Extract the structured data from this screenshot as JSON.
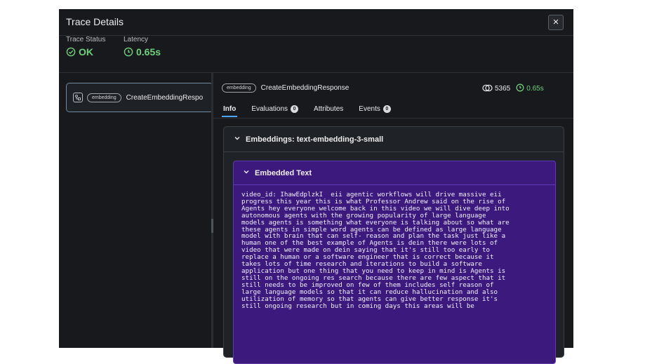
{
  "header": {
    "title": "Trace Details",
    "close_label": "×"
  },
  "status": {
    "status_label": "Trace Status",
    "status_value": "OK",
    "latency_label": "Latency",
    "latency_value": "0.65s",
    "ok_color": "#6fd17b"
  },
  "span_list": {
    "items": [
      {
        "icon": "embedding-kind-icon",
        "badge": "embedding",
        "name": "CreateEmbeddingResponse",
        "shown_name": "CreateEmbeddingRespo"
      }
    ]
  },
  "detail": {
    "badge": "embedding",
    "name": "CreateEmbeddingResponse",
    "tokens": "5365",
    "latency": "0.65s",
    "tabs": [
      {
        "label": "Info",
        "count": null,
        "active": true
      },
      {
        "label": "Evaluations",
        "count": "0"
      },
      {
        "label": "Attributes",
        "count": null
      },
      {
        "label": "Events",
        "count": "0"
      }
    ],
    "embeddings_title": "Embeddings: text-embedding-3-small",
    "embedded_text_title": "Embedded Text",
    "embedded_text_lines": [
      "video_id: IhawEdplzkI  eii agentic workflows will drive massive eii",
      "progress this year this is what Professor Andrew said on the rise of",
      "Agents hey everyone welcome back in this video we will dive deep into",
      "autonomous agents with the growing popularity of large language",
      "models agents is something what everyone is talking about so what are",
      "these agents in simple word agents can be defined as large language",
      "model with brain that can self- reason and plan the task just like a",
      "human one of the best example of Agents is dein there were lots of",
      "video that were made on dein saying that it's still too early to",
      "replace a human or a software engineer that is correct because it",
      "takes lots of time research and iterations to build a software",
      "application but one thing that you need to keep in mind is Agents is",
      "still on the ongoing res search because there are few aspect that it",
      "still needs to be improved on few of them includes self reason of",
      "large language models so that it can reduce hallucination and also",
      "utilization of memory so that agents can give better response it's",
      "still ongoing research but in coming days this areas will be"
    ]
  },
  "colors": {
    "panel_bg": "#17191c",
    "accent": "#49a7ff",
    "embedded_bg": "#3c1a7d"
  }
}
